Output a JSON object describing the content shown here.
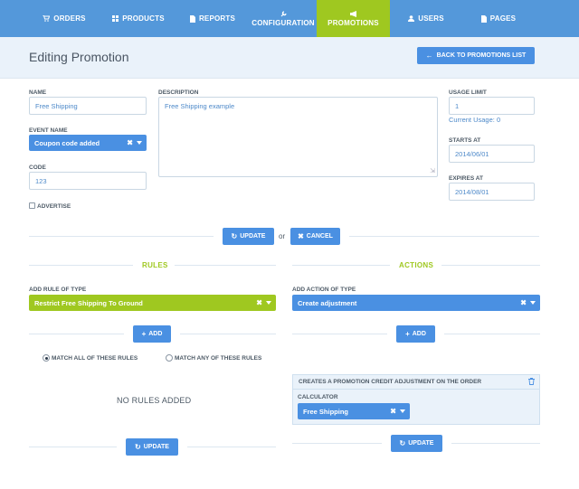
{
  "nav": {
    "items": [
      {
        "label": "ORDERS",
        "icon": "cart-icon"
      },
      {
        "label": "PRODUCTS",
        "icon": "grid-icon"
      },
      {
        "label": "REPORTS",
        "icon": "file-icon"
      },
      {
        "label": "CONFIGURATION",
        "icon": "wrench-icon"
      },
      {
        "label": "PROMOTIONS",
        "icon": "bullhorn-icon",
        "active": true
      },
      {
        "label": "USERS",
        "icon": "user-icon"
      },
      {
        "label": "PAGES",
        "icon": "page-icon"
      }
    ]
  },
  "header": {
    "title": "Editing Promotion",
    "back_label": "BACK TO PROMOTIONS LIST"
  },
  "form": {
    "name_label": "NAME",
    "name_value": "Free Shipping",
    "event_name_label": "EVENT NAME",
    "event_name_value": "Coupon code added",
    "code_label": "CODE",
    "code_value": "123",
    "advertise_label": "ADVERTISE",
    "description_label": "DESCRIPTION",
    "description_value": "Free Shipping example",
    "usage_limit_label": "USAGE LIMIT",
    "usage_limit_value": "1",
    "current_usage": "Current Usage: 0",
    "starts_at_label": "STARTS AT",
    "starts_at_value": "2014/06/01",
    "expires_at_label": "EXPIRES AT",
    "expires_at_value": "2014/08/01"
  },
  "form_actions": {
    "update_label": "UPDATE",
    "or_text": "or",
    "cancel_label": "CANCEL"
  },
  "rules": {
    "title": "RULES",
    "add_label": "ADD RULE OF TYPE",
    "selected": "Restrict Free Shipping To Ground",
    "add_button": "ADD",
    "match_all": "MATCH ALL OF THESE RULES",
    "match_any": "MATCH ANY OF THESE RULES",
    "match_mode": "all",
    "empty": "NO RULES ADDED",
    "update_button": "UPDATE"
  },
  "actions": {
    "title": "ACTIONS",
    "add_label": "ADD ACTION OF TYPE",
    "selected": "Create adjustment",
    "add_button": "ADD",
    "panel_title": "CREATES A PROMOTION CREDIT ADJUSTMENT ON THE ORDER",
    "calculator_label": "CALCULATOR",
    "calculator_value": "Free Shipping",
    "update_button": "UPDATE"
  },
  "colors": {
    "nav_bg": "#5498da",
    "accent_green": "#9fc820",
    "button_blue": "#4a90e2",
    "header_band": "#eaf2fa"
  }
}
